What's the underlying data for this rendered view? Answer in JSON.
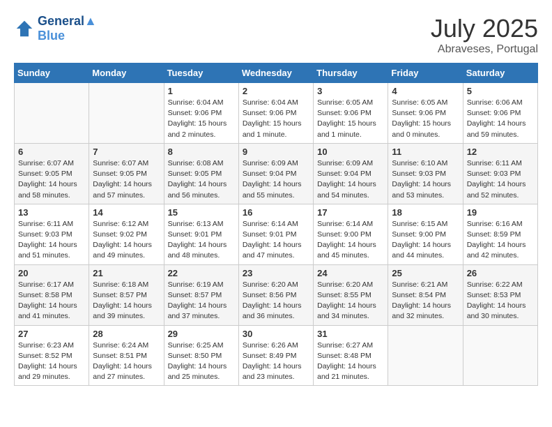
{
  "header": {
    "logo_line1": "General",
    "logo_line2": "Blue",
    "month": "July 2025",
    "location": "Abraveses, Portugal"
  },
  "days_of_week": [
    "Sunday",
    "Monday",
    "Tuesday",
    "Wednesday",
    "Thursday",
    "Friday",
    "Saturday"
  ],
  "weeks": [
    [
      {
        "num": "",
        "sunrise": "",
        "sunset": "",
        "daylight": ""
      },
      {
        "num": "",
        "sunrise": "",
        "sunset": "",
        "daylight": ""
      },
      {
        "num": "1",
        "sunrise": "Sunrise: 6:04 AM",
        "sunset": "Sunset: 9:06 PM",
        "daylight": "Daylight: 15 hours and 2 minutes."
      },
      {
        "num": "2",
        "sunrise": "Sunrise: 6:04 AM",
        "sunset": "Sunset: 9:06 PM",
        "daylight": "Daylight: 15 hours and 1 minute."
      },
      {
        "num": "3",
        "sunrise": "Sunrise: 6:05 AM",
        "sunset": "Sunset: 9:06 PM",
        "daylight": "Daylight: 15 hours and 1 minute."
      },
      {
        "num": "4",
        "sunrise": "Sunrise: 6:05 AM",
        "sunset": "Sunset: 9:06 PM",
        "daylight": "Daylight: 15 hours and 0 minutes."
      },
      {
        "num": "5",
        "sunrise": "Sunrise: 6:06 AM",
        "sunset": "Sunset: 9:06 PM",
        "daylight": "Daylight: 14 hours and 59 minutes."
      }
    ],
    [
      {
        "num": "6",
        "sunrise": "Sunrise: 6:07 AM",
        "sunset": "Sunset: 9:05 PM",
        "daylight": "Daylight: 14 hours and 58 minutes."
      },
      {
        "num": "7",
        "sunrise": "Sunrise: 6:07 AM",
        "sunset": "Sunset: 9:05 PM",
        "daylight": "Daylight: 14 hours and 57 minutes."
      },
      {
        "num": "8",
        "sunrise": "Sunrise: 6:08 AM",
        "sunset": "Sunset: 9:05 PM",
        "daylight": "Daylight: 14 hours and 56 minutes."
      },
      {
        "num": "9",
        "sunrise": "Sunrise: 6:09 AM",
        "sunset": "Sunset: 9:04 PM",
        "daylight": "Daylight: 14 hours and 55 minutes."
      },
      {
        "num": "10",
        "sunrise": "Sunrise: 6:09 AM",
        "sunset": "Sunset: 9:04 PM",
        "daylight": "Daylight: 14 hours and 54 minutes."
      },
      {
        "num": "11",
        "sunrise": "Sunrise: 6:10 AM",
        "sunset": "Sunset: 9:03 PM",
        "daylight": "Daylight: 14 hours and 53 minutes."
      },
      {
        "num": "12",
        "sunrise": "Sunrise: 6:11 AM",
        "sunset": "Sunset: 9:03 PM",
        "daylight": "Daylight: 14 hours and 52 minutes."
      }
    ],
    [
      {
        "num": "13",
        "sunrise": "Sunrise: 6:11 AM",
        "sunset": "Sunset: 9:03 PM",
        "daylight": "Daylight: 14 hours and 51 minutes."
      },
      {
        "num": "14",
        "sunrise": "Sunrise: 6:12 AM",
        "sunset": "Sunset: 9:02 PM",
        "daylight": "Daylight: 14 hours and 49 minutes."
      },
      {
        "num": "15",
        "sunrise": "Sunrise: 6:13 AM",
        "sunset": "Sunset: 9:01 PM",
        "daylight": "Daylight: 14 hours and 48 minutes."
      },
      {
        "num": "16",
        "sunrise": "Sunrise: 6:14 AM",
        "sunset": "Sunset: 9:01 PM",
        "daylight": "Daylight: 14 hours and 47 minutes."
      },
      {
        "num": "17",
        "sunrise": "Sunrise: 6:14 AM",
        "sunset": "Sunset: 9:00 PM",
        "daylight": "Daylight: 14 hours and 45 minutes."
      },
      {
        "num": "18",
        "sunrise": "Sunrise: 6:15 AM",
        "sunset": "Sunset: 9:00 PM",
        "daylight": "Daylight: 14 hours and 44 minutes."
      },
      {
        "num": "19",
        "sunrise": "Sunrise: 6:16 AM",
        "sunset": "Sunset: 8:59 PM",
        "daylight": "Daylight: 14 hours and 42 minutes."
      }
    ],
    [
      {
        "num": "20",
        "sunrise": "Sunrise: 6:17 AM",
        "sunset": "Sunset: 8:58 PM",
        "daylight": "Daylight: 14 hours and 41 minutes."
      },
      {
        "num": "21",
        "sunrise": "Sunrise: 6:18 AM",
        "sunset": "Sunset: 8:57 PM",
        "daylight": "Daylight: 14 hours and 39 minutes."
      },
      {
        "num": "22",
        "sunrise": "Sunrise: 6:19 AM",
        "sunset": "Sunset: 8:57 PM",
        "daylight": "Daylight: 14 hours and 37 minutes."
      },
      {
        "num": "23",
        "sunrise": "Sunrise: 6:20 AM",
        "sunset": "Sunset: 8:56 PM",
        "daylight": "Daylight: 14 hours and 36 minutes."
      },
      {
        "num": "24",
        "sunrise": "Sunrise: 6:20 AM",
        "sunset": "Sunset: 8:55 PM",
        "daylight": "Daylight: 14 hours and 34 minutes."
      },
      {
        "num": "25",
        "sunrise": "Sunrise: 6:21 AM",
        "sunset": "Sunset: 8:54 PM",
        "daylight": "Daylight: 14 hours and 32 minutes."
      },
      {
        "num": "26",
        "sunrise": "Sunrise: 6:22 AM",
        "sunset": "Sunset: 8:53 PM",
        "daylight": "Daylight: 14 hours and 30 minutes."
      }
    ],
    [
      {
        "num": "27",
        "sunrise": "Sunrise: 6:23 AM",
        "sunset": "Sunset: 8:52 PM",
        "daylight": "Daylight: 14 hours and 29 minutes."
      },
      {
        "num": "28",
        "sunrise": "Sunrise: 6:24 AM",
        "sunset": "Sunset: 8:51 PM",
        "daylight": "Daylight: 14 hours and 27 minutes."
      },
      {
        "num": "29",
        "sunrise": "Sunrise: 6:25 AM",
        "sunset": "Sunset: 8:50 PM",
        "daylight": "Daylight: 14 hours and 25 minutes."
      },
      {
        "num": "30",
        "sunrise": "Sunrise: 6:26 AM",
        "sunset": "Sunset: 8:49 PM",
        "daylight": "Daylight: 14 hours and 23 minutes."
      },
      {
        "num": "31",
        "sunrise": "Sunrise: 6:27 AM",
        "sunset": "Sunset: 8:48 PM",
        "daylight": "Daylight: 14 hours and 21 minutes."
      },
      {
        "num": "",
        "sunrise": "",
        "sunset": "",
        "daylight": ""
      },
      {
        "num": "",
        "sunrise": "",
        "sunset": "",
        "daylight": ""
      }
    ]
  ]
}
